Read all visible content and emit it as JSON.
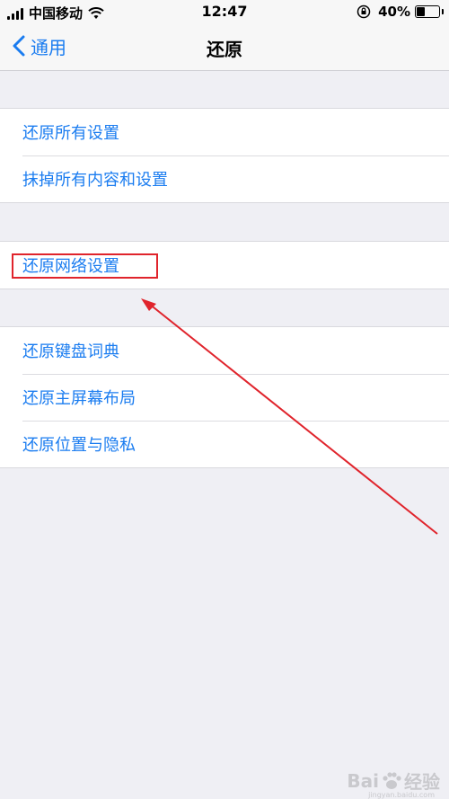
{
  "status_bar": {
    "carrier": "中国移动",
    "time": "12:47",
    "battery_percent_label": "40%",
    "battery_level": 0.4
  },
  "nav": {
    "back_label": "通用",
    "title": "还原"
  },
  "groups": [
    {
      "items": [
        "还原所有设置",
        "抹掉所有内容和设置"
      ]
    },
    {
      "items": [
        "还原网络设置"
      ]
    },
    {
      "items": [
        "还原键盘词典",
        "还原主屏幕布局",
        "还原位置与隐私"
      ]
    }
  ],
  "colors": {
    "accent": "#1a7cf0",
    "annotation": "#e0242c",
    "background": "#efeff4"
  },
  "watermark": {
    "brand_left": "Bai",
    "brand_right": "经验",
    "url": "jingyan.baidu.com"
  }
}
